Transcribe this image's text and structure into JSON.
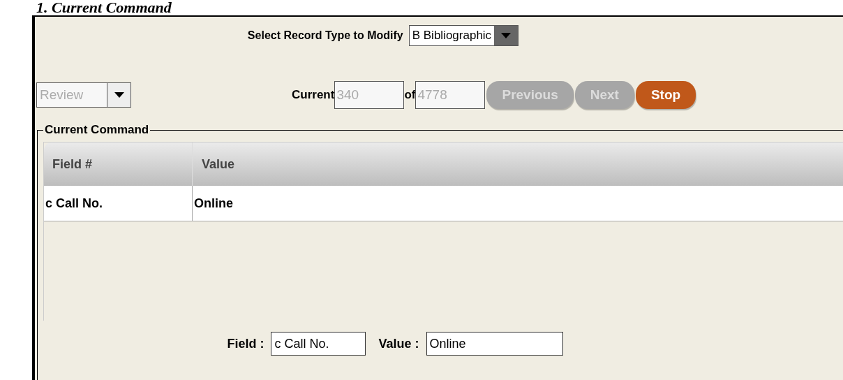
{
  "heading": "1. Current Command",
  "record_type": {
    "label": "Select Record Type to Modify",
    "value": "B Bibliographic"
  },
  "mode": {
    "value": "Review",
    "disabled": true
  },
  "navigation": {
    "current_label": "Current",
    "current": "340",
    "of_label": "of",
    "total": "4778"
  },
  "buttons": [
    {
      "label": "Previous",
      "disabled": true,
      "kind": "grey"
    },
    {
      "label": "Next",
      "disabled": true,
      "kind": "grey"
    },
    {
      "label": "Stop",
      "disabled": false,
      "kind": "orange"
    }
  ],
  "group_title": "Current Command",
  "table": {
    "columns": [
      "Field #",
      "Value"
    ],
    "rows": [
      [
        "c Call No.",
        "Online"
      ]
    ]
  },
  "editor": {
    "field_label": "Field :",
    "field_value": "c Call No.",
    "value_label": "Value :",
    "value_value": "Online"
  }
}
